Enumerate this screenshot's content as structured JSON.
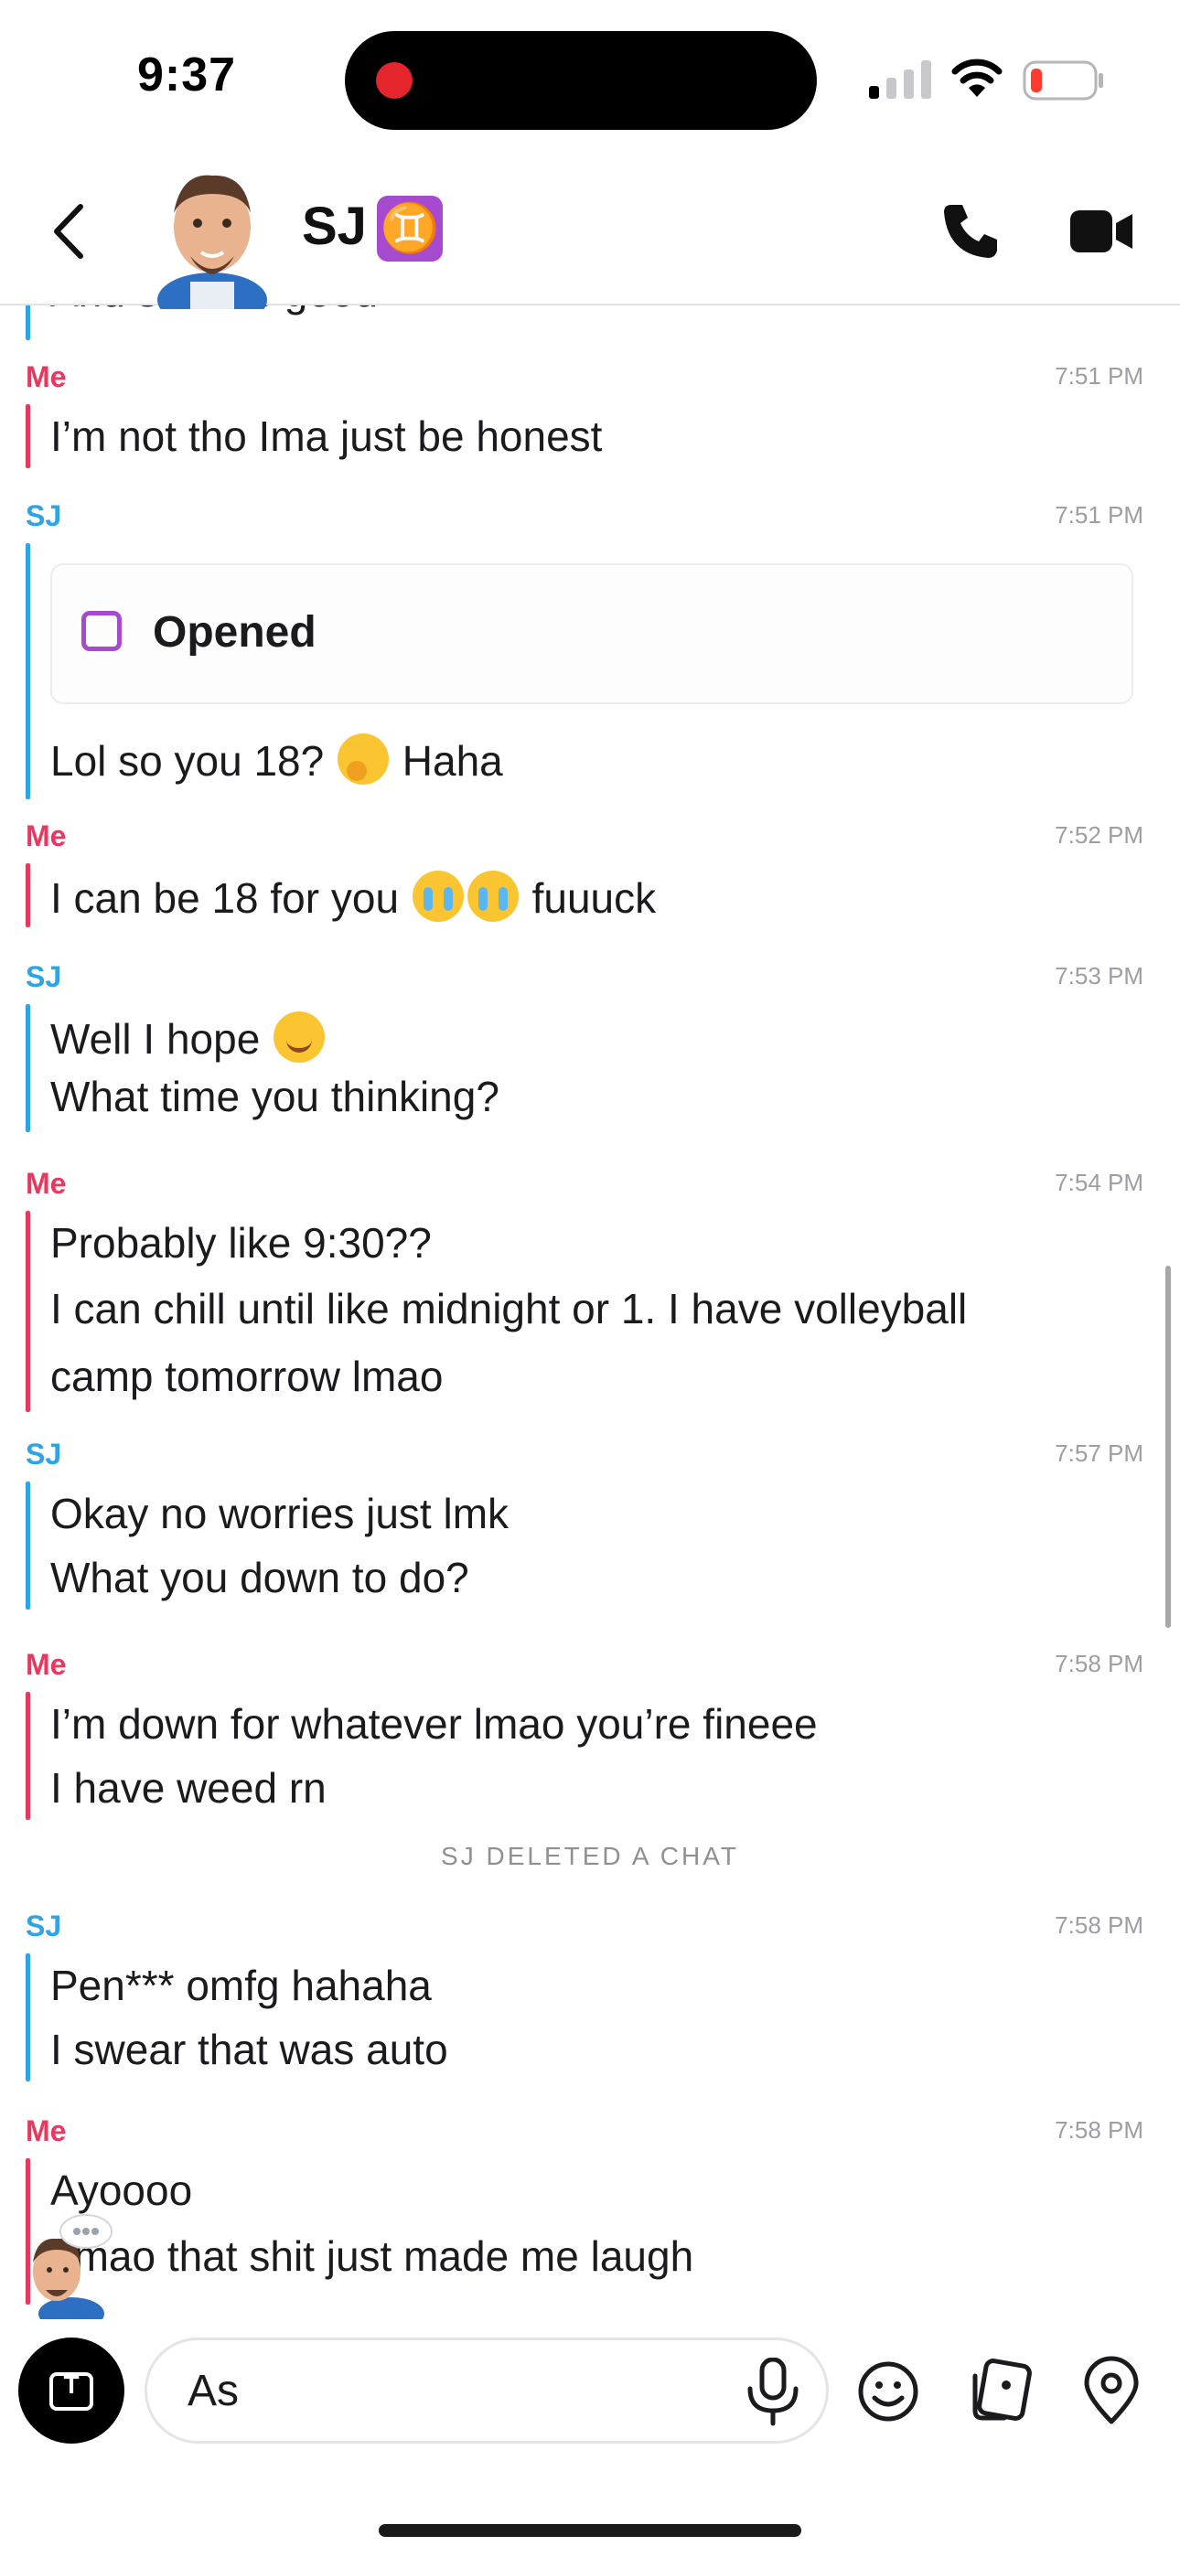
{
  "status_bar": {
    "time": "9:37"
  },
  "header": {
    "title": "SJ",
    "zodiac": "♊"
  },
  "messages": [
    {
      "sender": "SJ",
      "time": "",
      "lines": [
        "And sounds good"
      ]
    },
    {
      "sender": "Me",
      "time": "7:51 PM",
      "lines": [
        "I’m not tho Ima just be honest"
      ]
    },
    {
      "sender": "SJ",
      "time": "7:51 PM",
      "snap": "Opened",
      "lines": [
        "Lol so you 18?",
        "Haha"
      ]
    },
    {
      "sender": "Me",
      "time": "7:52 PM",
      "lines": [
        "I can be 18 for you",
        "fuuuck"
      ]
    },
    {
      "sender": "SJ",
      "time": "7:53 PM",
      "lines": [
        "Well I hope",
        "What time you thinking?"
      ]
    },
    {
      "sender": "Me",
      "time": "7:54 PM",
      "lines": [
        "Probably like 9:30??",
        "I can chill until like midnight or 1. I have volleyball",
        "camp tomorrow lmao"
      ]
    },
    {
      "sender": "SJ",
      "time": "7:57 PM",
      "lines": [
        "Okay no worries just lmk",
        "What you down to do?"
      ]
    },
    {
      "sender": "Me",
      "time": "7:58 PM",
      "lines": [
        "I’m down for whatever lmao you’re fineee",
        "I have weed rn"
      ]
    },
    {
      "sender": "SJ",
      "time": "7:58 PM",
      "lines": [
        "Pen*** omfg hahaha",
        "I swear that was auto"
      ]
    },
    {
      "sender": "Me",
      "time": "7:58 PM",
      "lines": [
        "Ayoooo",
        "Lmao that shit just made me laugh"
      ]
    }
  ],
  "system": {
    "deleted_notice": "SJ DELETED A CHAT"
  },
  "composer": {
    "value": "As"
  },
  "colors": {
    "me": "#e8385f",
    "sj": "#2ba5e6",
    "snap_opened": "#a64ad0"
  }
}
